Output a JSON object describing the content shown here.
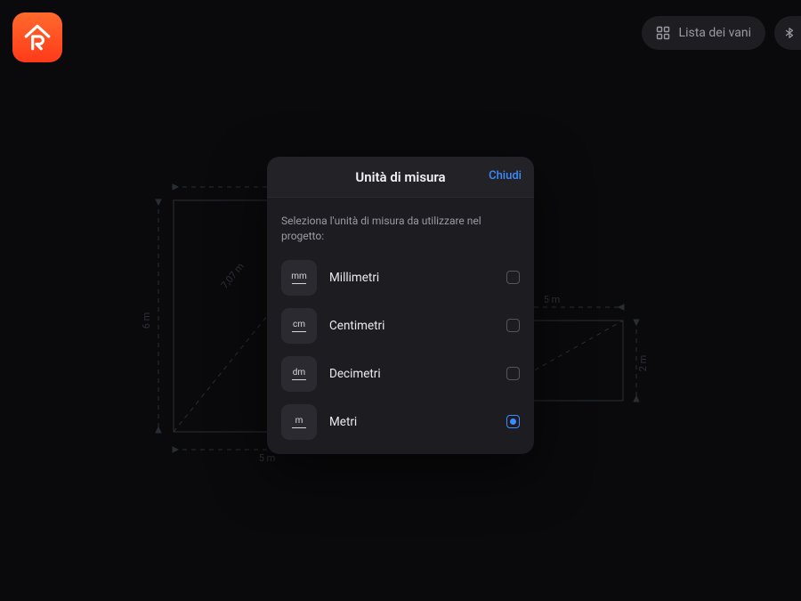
{
  "topbar": {
    "rooms_button": "Lista dei vani"
  },
  "modal": {
    "title": "Unità di misura",
    "close": "Chiudi",
    "hint": "Seleziona l'unità di misura da utilizzare nel progetto:",
    "options": [
      {
        "abbr": "mm",
        "label": "Millimetri",
        "selected": false
      },
      {
        "abbr": "cm",
        "label": "Centimetri",
        "selected": false
      },
      {
        "abbr": "dm",
        "label": "Decimetri",
        "selected": false
      },
      {
        "abbr": "m",
        "label": "Metri",
        "selected": true
      }
    ]
  },
  "plan": {
    "room1": {
      "width_label": "5 m",
      "height_label": "6 m",
      "diag_label": "7,07 m"
    },
    "room2": {
      "width_label": "5 m",
      "height_label": "2 m"
    }
  }
}
